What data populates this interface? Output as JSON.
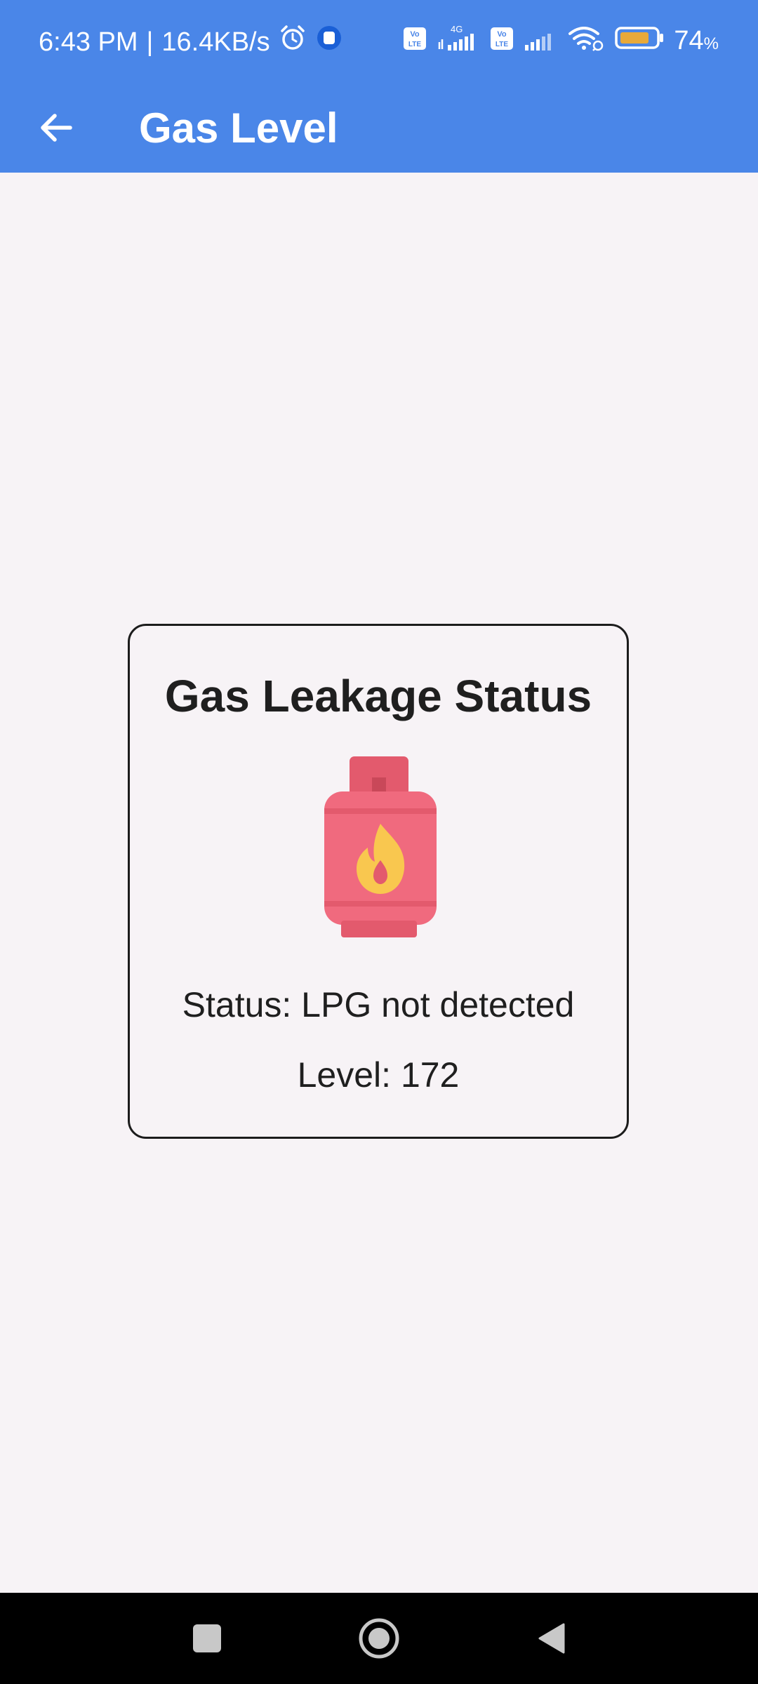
{
  "status_bar": {
    "time": "6:43 PM",
    "separator": "|",
    "speed": "16.4KB/s",
    "network_type": "4G",
    "battery_percent": "74",
    "battery_unit": "%",
    "icons": [
      "alarm-icon",
      "app-notification-icon",
      "volte-icon",
      "signal-icon",
      "volte-icon",
      "signal-icon",
      "wifi-icon",
      "battery-icon"
    ]
  },
  "app_bar": {
    "title": "Gas Level",
    "back_icon": "arrow-left-icon"
  },
  "card": {
    "title": "Gas Leakage Status",
    "image": "gas-cylinder-icon",
    "status": "Status: LPG not detected",
    "level": "Level: 172"
  },
  "nav_bar": {
    "buttons": [
      "recents-square-icon",
      "home-circle-icon",
      "back-triangle-icon"
    ]
  },
  "colors": {
    "primary": "#4a86e8",
    "background": "#f7f3f6",
    "cylinder": "#f06a7e",
    "flame": "#f9c74f"
  }
}
